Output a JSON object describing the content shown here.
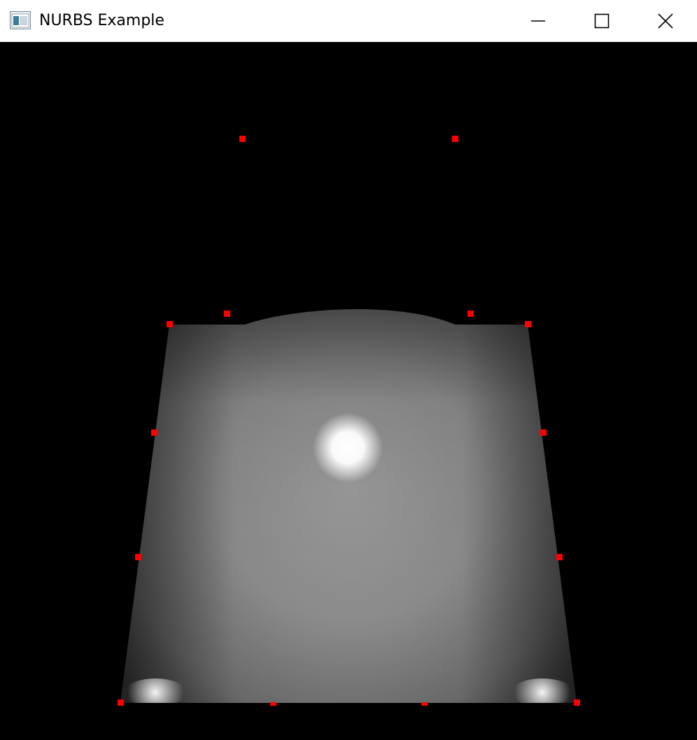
{
  "window": {
    "title": "NURBS Example",
    "icon": "app-window-icon",
    "controls": {
      "minimize_icon": "minimize-icon",
      "maximize_icon": "maximize-icon",
      "close_icon": "close-icon"
    }
  },
  "scene": {
    "background_color": "#000000",
    "surface_color": "#9a9a9a",
    "control_point_color": "#ff0000",
    "control_point_count": 16
  }
}
